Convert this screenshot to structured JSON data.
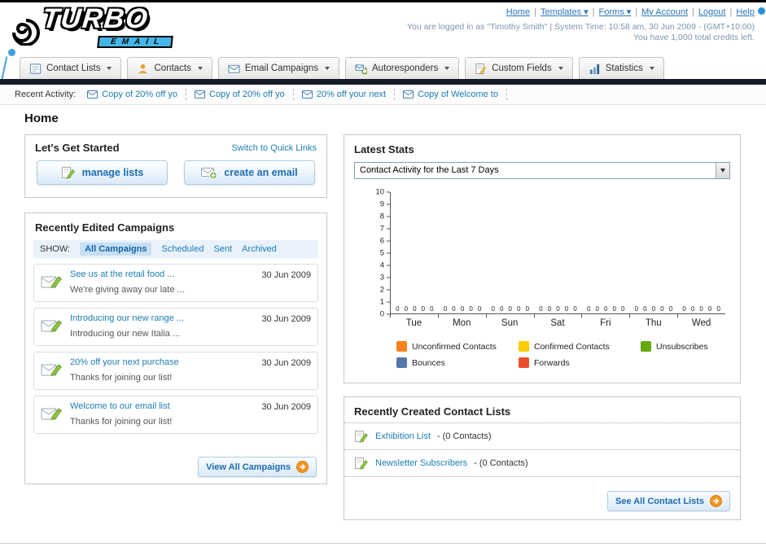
{
  "header": {
    "logo_text": "TURBO",
    "logo_sub": "EMAIL",
    "nav": [
      {
        "label": "Home"
      },
      {
        "label": "Templates ▾"
      },
      {
        "label": "Forms ▾"
      },
      {
        "label": "My Account"
      },
      {
        "label": "Logout"
      },
      {
        "label": "Help"
      }
    ],
    "session_info": "You are logged in as \"Timothy Smith\" | System Time: 10:58 am, 30 Jun 2009 - (GMT+10:00)",
    "credits_info": "You have 1,000 total credits left."
  },
  "tabs": [
    {
      "label": "Contact Lists"
    },
    {
      "label": "Contacts"
    },
    {
      "label": "Email Campaigns"
    },
    {
      "label": "Autoresponders"
    },
    {
      "label": "Custom Fields"
    },
    {
      "label": "Statistics"
    }
  ],
  "activity": {
    "label": "Recent Activity:",
    "items": [
      {
        "label": "Copy of 20% off yo"
      },
      {
        "label": "Copy of 20% off yo"
      },
      {
        "label": "20% off your next"
      },
      {
        "label": "Copy of Welcome to"
      }
    ]
  },
  "page": {
    "title": "Home"
  },
  "get_started": {
    "title": "Let's Get Started",
    "switch_link": "Switch to Quick Links",
    "manage_lists_label": "manage lists",
    "create_email_label": "create an email"
  },
  "campaigns": {
    "title": "Recently Edited Campaigns",
    "show_label": "SHOW:",
    "filters": [
      "All Campaigns",
      "Scheduled",
      "Sent",
      "Archived"
    ],
    "items": [
      {
        "title": "See us at the retail food ...",
        "subtitle": "We're giving away our late ...",
        "date": "30 Jun 2009"
      },
      {
        "title": "Introducing our new range ...",
        "subtitle": "Introducing our new Italia ...",
        "date": "30 Jun 2009"
      },
      {
        "title": "20% off your next purchase",
        "subtitle": "Thanks for joining our list!",
        "date": "30 Jun 2009"
      },
      {
        "title": "Welcome to our email list",
        "subtitle": "Thanks for joining our list!",
        "date": "30 Jun 2009"
      }
    ],
    "view_all_label": "View All Campaigns"
  },
  "latest_stats": {
    "title": "Latest Stats",
    "period_value": "Contact Activity for the Last 7 Days",
    "chart_data": {
      "type": "bar",
      "title": "Contact Activity for the Last 7 Days",
      "categories": [
        "Tue",
        "Mon",
        "Sun",
        "Sat",
        "Fri",
        "Thu",
        "Wed"
      ],
      "series": [
        {
          "name": "Unconfirmed Contacts",
          "color": "#f5821f",
          "values": [
            0,
            0,
            0,
            0,
            0,
            0,
            0
          ]
        },
        {
          "name": "Confirmed Contacts",
          "color": "#ffcc00",
          "values": [
            0,
            0,
            0,
            0,
            0,
            0,
            0
          ]
        },
        {
          "name": "Unsubscribes",
          "color": "#64a812",
          "values": [
            0,
            0,
            0,
            0,
            0,
            0,
            0
          ]
        },
        {
          "name": "Bounces",
          "color": "#5577aa",
          "values": [
            0,
            0,
            0,
            0,
            0,
            0,
            0
          ]
        },
        {
          "name": "Forwards",
          "color": "#e8512d",
          "values": [
            0,
            0,
            0,
            0,
            0,
            0,
            0
          ]
        }
      ],
      "ylim": [
        0,
        10
      ],
      "ytick_step": 1,
      "grid": false,
      "legend_position": "bottom"
    }
  },
  "contact_lists": {
    "title": "Recently Created Contact Lists",
    "items": [
      {
        "name": "Exhibition List",
        "suffix": "- (0 Contacts)"
      },
      {
        "name": "Newsletter Subscribers",
        "suffix": "- (0 Contacts)"
      }
    ],
    "see_all_label": "See All Contact Lists"
  }
}
